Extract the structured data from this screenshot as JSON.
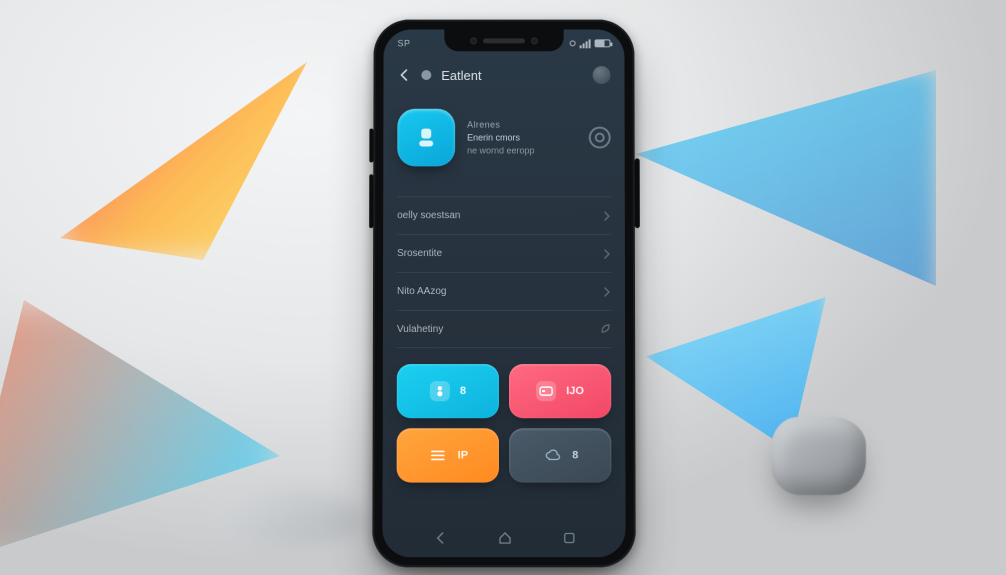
{
  "status": {
    "left": "SP",
    "right_label": ""
  },
  "header": {
    "title": "Eatlent"
  },
  "hero": {
    "chip_lines": [
      "",
      ""
    ],
    "overline": "Alrenes",
    "line1": "Enerin cmors",
    "line2": "ne wornd eeropp"
  },
  "list": [
    {
      "label": "oelly soestsan"
    },
    {
      "label": "Srosentite"
    },
    {
      "label": "Nito AAzog"
    },
    {
      "label": "Vulahetiny"
    }
  ],
  "tiles": {
    "a": {
      "label": "8"
    },
    "b": {
      "label": "IJO"
    },
    "c": {
      "label": "IP"
    },
    "d": {
      "label": "8"
    }
  },
  "colors": {
    "cyan": "#14c5ec",
    "pink": "#f7536f",
    "orange": "#ff8f2b",
    "slate": "#42505c"
  }
}
